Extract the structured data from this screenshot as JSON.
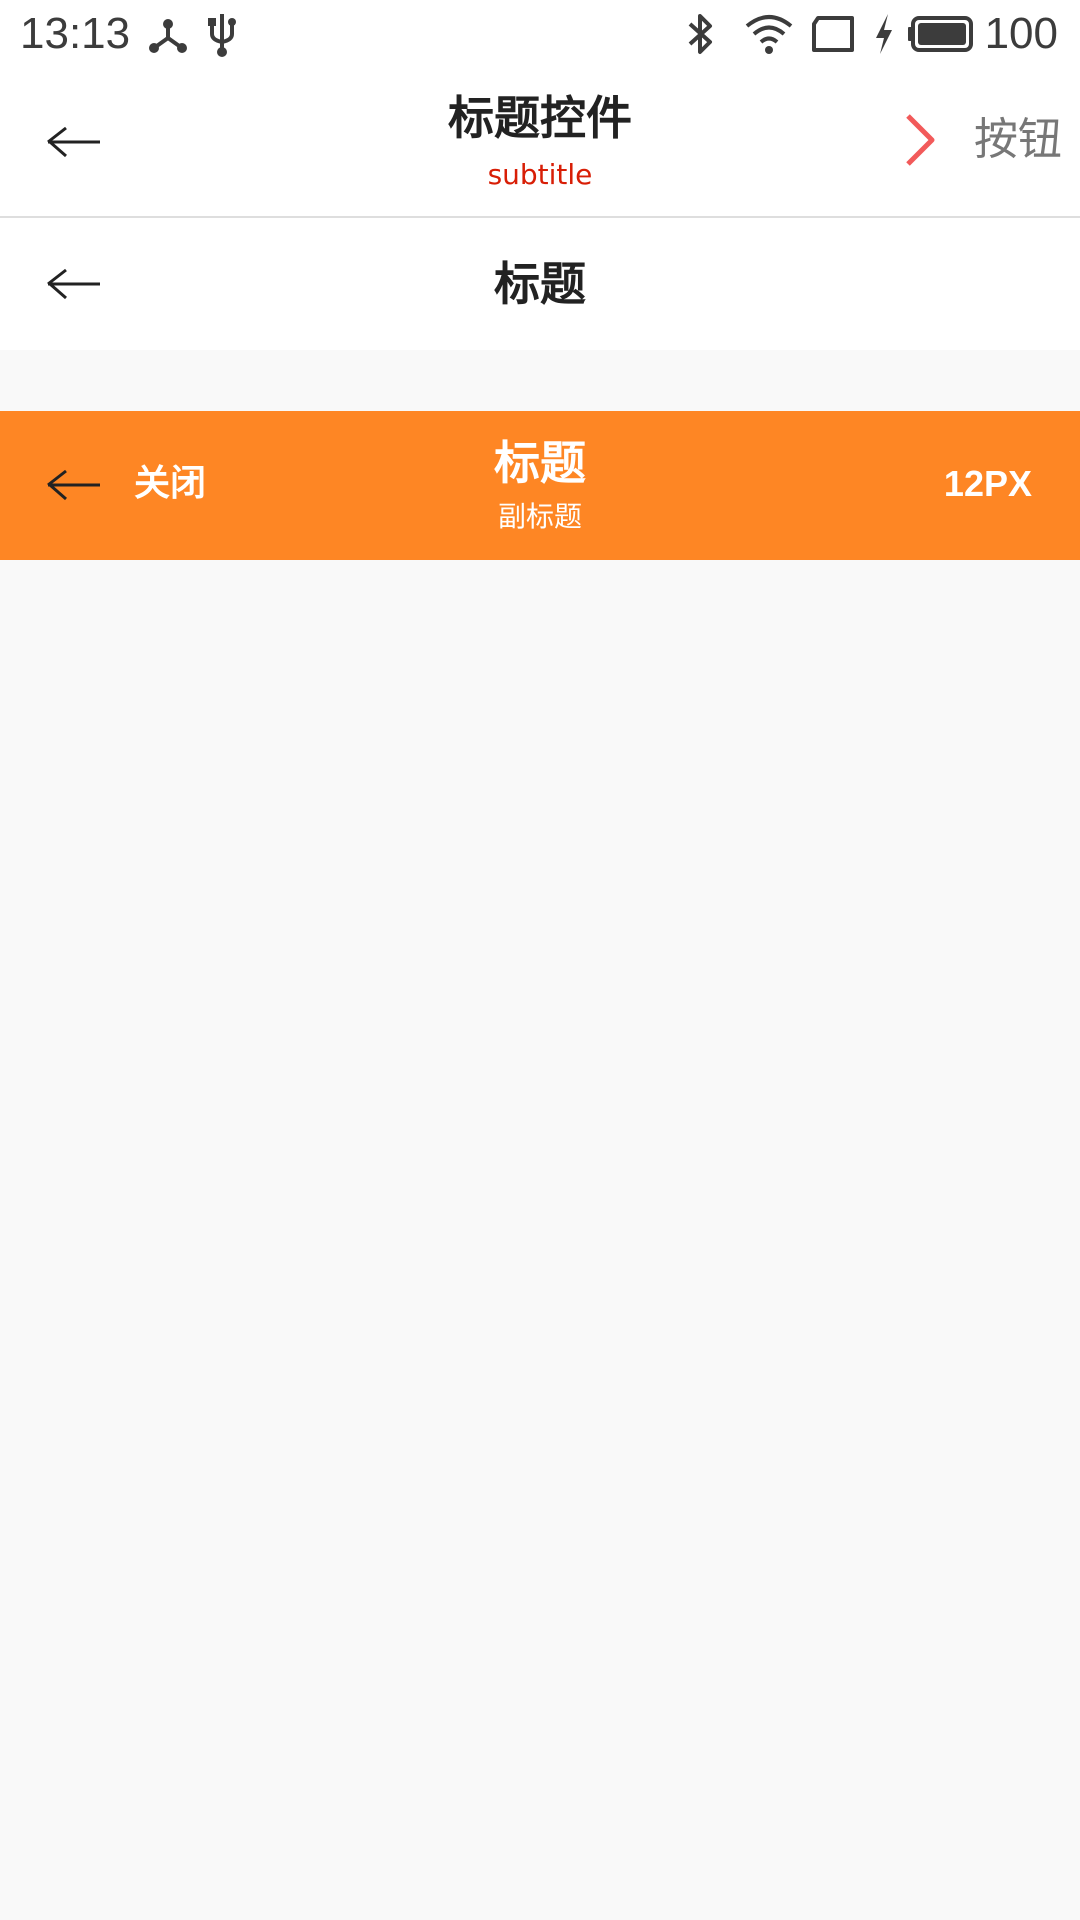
{
  "status_bar": {
    "time": "13:13",
    "battery": "100",
    "icons": [
      "share-network-icon",
      "usb-icon",
      "bluetooth-icon",
      "wifi-icon",
      "screen-cast-icon",
      "charging-bolt-icon",
      "battery-icon"
    ]
  },
  "title_bar_1": {
    "title": "标题控件",
    "subtitle": "subtitle",
    "right_button_label": "按钮",
    "subtitle_color": "#d81e06",
    "chevron_color": "#f25a5a"
  },
  "title_bar_2": {
    "title": "标题"
  },
  "title_bar_3": {
    "close_label": "关闭",
    "title": "标题",
    "subtitle": "副标题",
    "right_text": "12PX",
    "background_color": "#fe8624"
  }
}
